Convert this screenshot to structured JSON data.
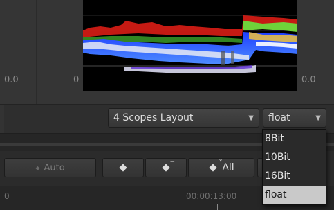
{
  "scopes": {
    "left_value": "0.0",
    "mid_value": "0",
    "right_value": "0.0"
  },
  "layout_select": {
    "value": "4 Scopes Layout",
    "arrow": "▼"
  },
  "bit_select": {
    "value": "float",
    "arrow": "▼",
    "options": [
      "8Bit",
      "10Bit",
      "16Bit",
      "float"
    ],
    "selected_index": 3
  },
  "keyframe_buttons": {
    "auto_label": "Auto",
    "all_label": "All",
    "prev_suffix": "−",
    "all_suffix": "*"
  },
  "timeline": {
    "left_marker": "0",
    "timecode": "00:00:13:00"
  },
  "colors": {
    "scope_bg": "#000000",
    "popup_selected_bg": "#c9c9c9",
    "waveform_red": "#e0261e",
    "waveform_green": "#6fd23a",
    "waveform_blue": "#2f6dff",
    "waveform_white": "#f2f2f2"
  }
}
